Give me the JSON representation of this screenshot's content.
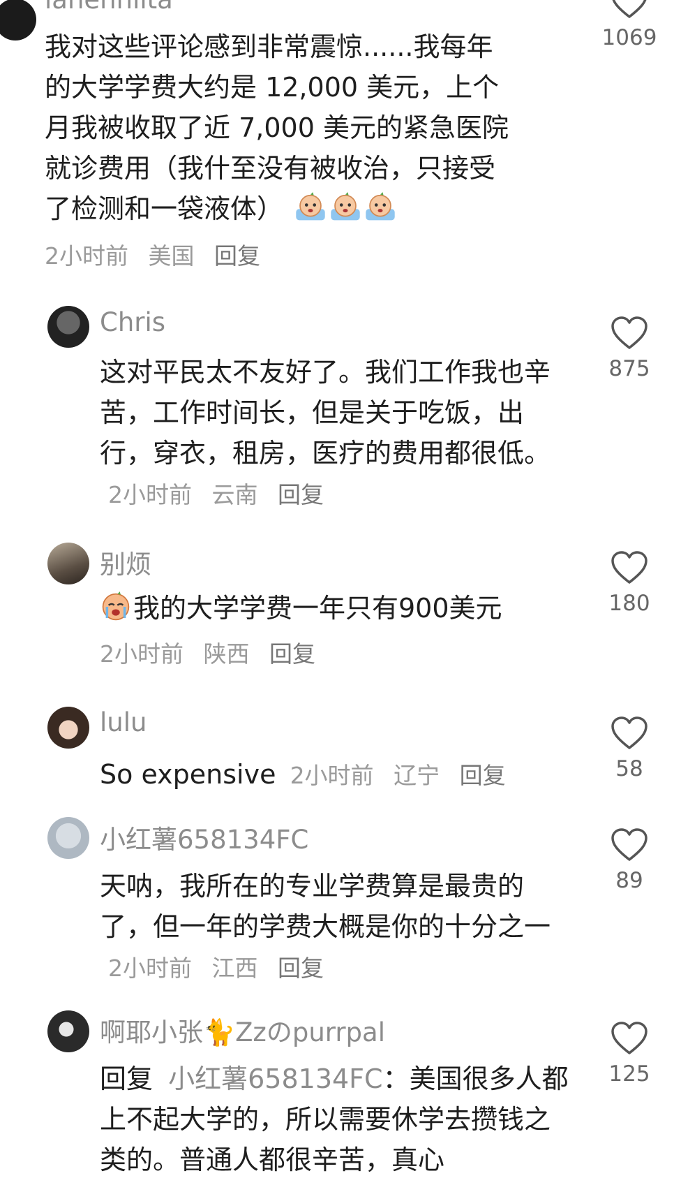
{
  "comments": [
    {
      "username": "lanehnlita",
      "text": "我对这些评论感到非常震惊......我每年的大学学费大约是 12,000 美元，上个月我被收取了近 7,000 美元的紧急医院就诊费用（我什至没有被收治，只接受了检测和一袋液体）",
      "time": "2小时前",
      "location": "美国",
      "reply": "回复",
      "likes": "1069"
    },
    {
      "username": "Chris",
      "text": "这对平民太不友好了。我们工作我也辛苦，工作时间长，但是关于吃饭，出行，穿衣，租房，医疗的费用都很低。",
      "time": "2小时前",
      "location": "云南",
      "reply": "回复",
      "likes": "875"
    },
    {
      "username": "别烦",
      "text": "我的大学学费一年只有900美元",
      "time": "2小时前",
      "location": "陕西",
      "reply": "回复",
      "likes": "180"
    },
    {
      "username": "lulu",
      "text": "So expensive",
      "time": "2小时前",
      "location": "辽宁",
      "reply": "回复",
      "likes": "58"
    },
    {
      "username": "小红薯658134FC",
      "text": "天呐，我所在的专业学费算是最贵的了，但一年的学费大概是你的十分之一",
      "time": "2小时前",
      "location": "江西",
      "reply": "回复",
      "likes": "89"
    },
    {
      "username": "啊耶小张🐈Zzのpurrpal",
      "reply_prefix": "回复",
      "reply_target": "小红薯658134FC",
      "text": "：美国很多人都上不起大学的，所以需要休学去攒钱之类的。普通人都很辛苦，真心",
      "likes": "125"
    }
  ],
  "icons": {
    "like": "heart-outline-icon",
    "emoji_crying": "crying-emoji-icon"
  }
}
